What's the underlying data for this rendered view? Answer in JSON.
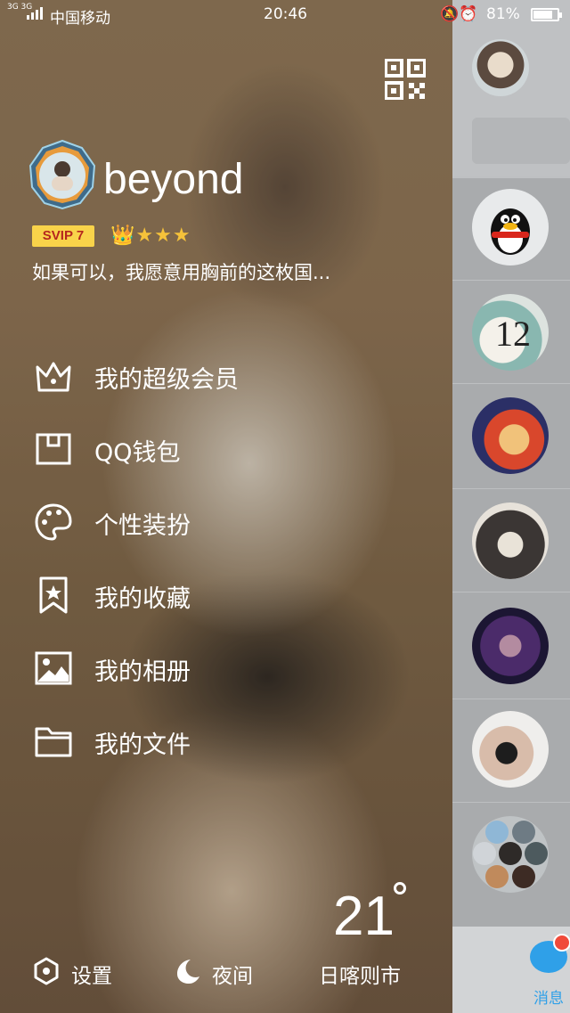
{
  "status_bar": {
    "network": "3G 3G",
    "carrier": "中国移动",
    "time": "20:46",
    "battery_percent": "81%",
    "battery_level": 0.81
  },
  "header": {
    "qr_icon": "qr-code-icon"
  },
  "profile": {
    "username": "beyond",
    "svip_badge": "SVIP 7",
    "level_icons": "👑★★★",
    "signature": "如果可以，我愿意用胸前的这枚国..."
  },
  "menu": {
    "items": [
      {
        "label": "我的超级会员",
        "icon": "crown-icon"
      },
      {
        "label": "QQ钱包",
        "icon": "wallet-icon"
      },
      {
        "label": "个性装扮",
        "icon": "palette-icon"
      },
      {
        "label": "我的收藏",
        "icon": "bookmark-icon"
      },
      {
        "label": "我的相册",
        "icon": "photo-album-icon"
      },
      {
        "label": "我的文件",
        "icon": "folder-icon"
      }
    ]
  },
  "weather": {
    "temperature": "21",
    "city": "日喀则市"
  },
  "bottom": {
    "settings_label": "设置",
    "night_label": "夜间"
  },
  "right_panel": {
    "tab_label": "消息",
    "unread_dot": true
  },
  "colors": {
    "accent_blue": "#2fa0e8",
    "svip_yellow": "#f9d34a",
    "badge_red": "#f04a3a"
  }
}
